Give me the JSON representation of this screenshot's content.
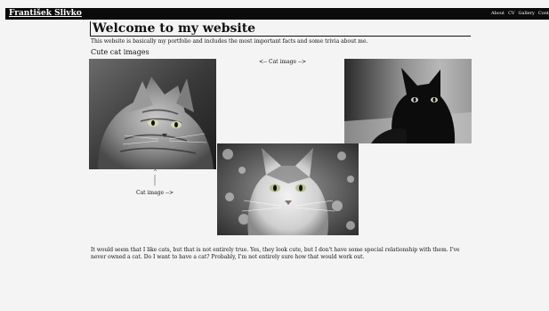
{
  "header": {
    "site_name": "František Slivko",
    "nav": [
      "About",
      "CV",
      "Gallery",
      "Conta"
    ]
  },
  "main": {
    "title": "Welcome to my website",
    "intro": "This website is basically my portfolio and includes the most important facts and some trivia about me.",
    "section_title": "Cute cat images",
    "caption_right": "<-- Cat image -->",
    "pointer_glyphs": [
      "^",
      "|",
      "|"
    ],
    "caption_left": "Cat image -->",
    "paragraph": "It would seem that I like cats, but that is not entirely true. Yes, they look cute, but I don't have some special relationship with them. I've never owned a cat. Do I want to have a cat? Probably, I'm not entirely sure how that would work out."
  },
  "colors": {
    "topbar": "#0b0b0b",
    "page_background": "#f4f4f4",
    "text": "#111111"
  }
}
